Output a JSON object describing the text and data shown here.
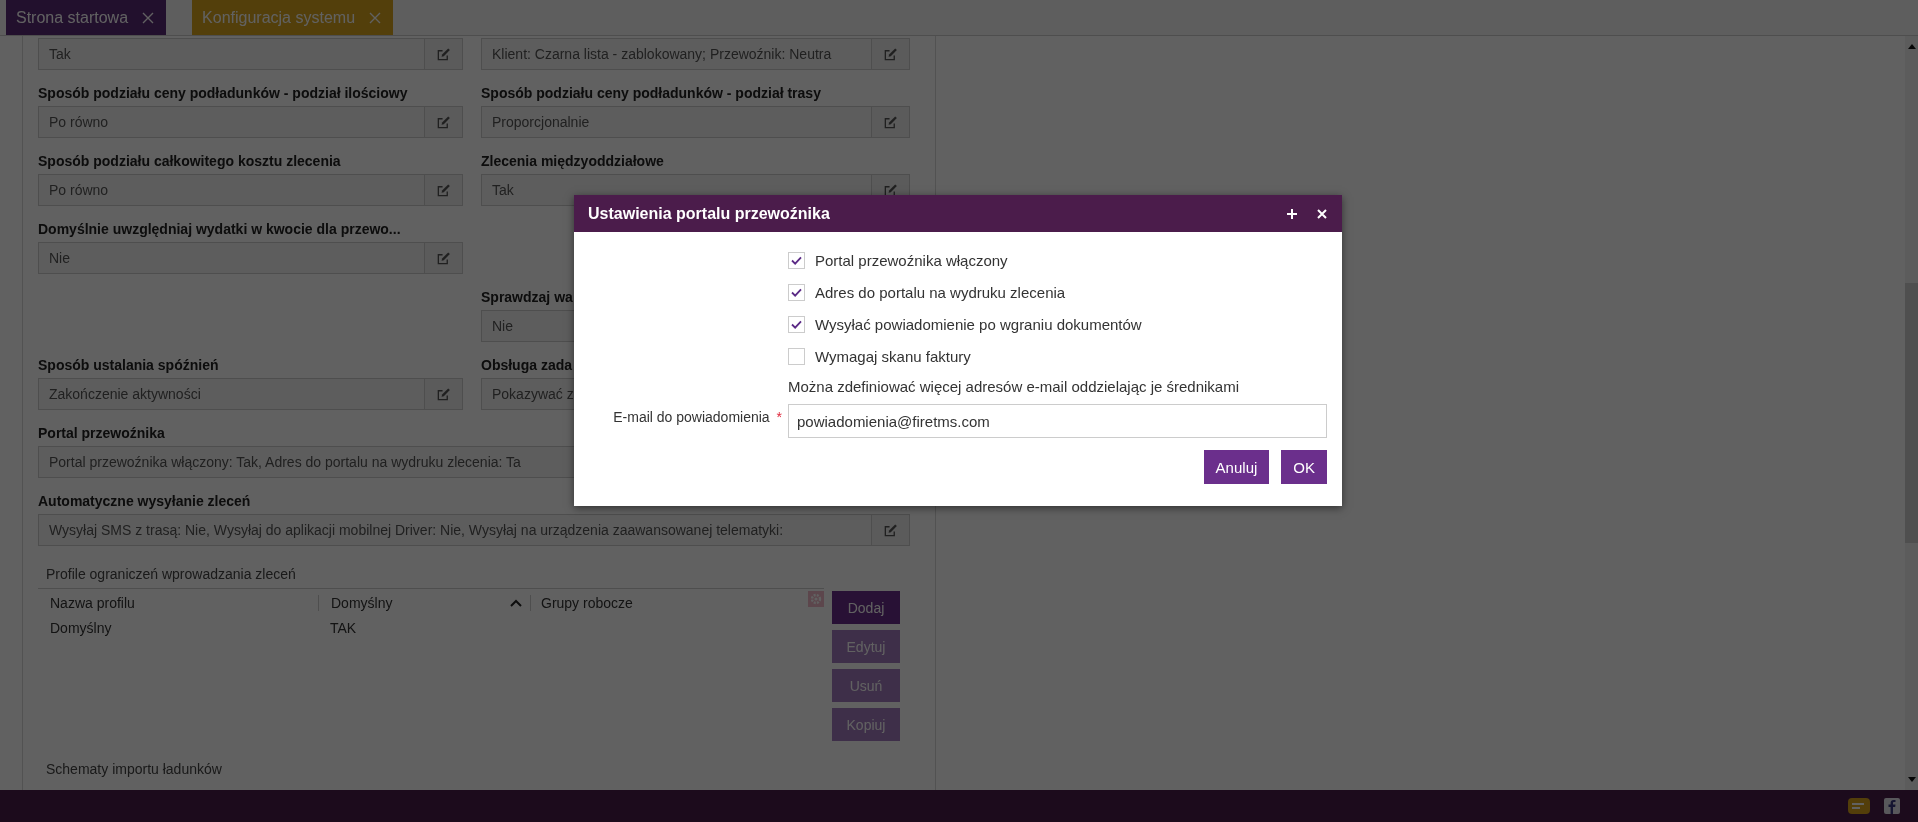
{
  "tabs": [
    {
      "label": "Strona startowa",
      "selected": false
    },
    {
      "label": "Konfiguracja systemu",
      "selected": true
    }
  ],
  "form": {
    "rows": [
      {
        "kind": "pair",
        "cells": [
          {
            "kind": "field",
            "value": "Tak",
            "editable": true
          },
          {
            "kind": "field",
            "value": "Klient: Czarna lista - zablokowany; Przewoźnik: Neutra",
            "editable": true
          }
        ]
      },
      {
        "kind": "pair",
        "cells": [
          {
            "kind": "field",
            "label": "Sposób podziału ceny podładunków - podział ilościowy",
            "value": "Po równo",
            "editable": true
          },
          {
            "kind": "field",
            "label": "Sposób podziału ceny podładunków - podział trasy",
            "value": "Proporcjonalnie",
            "editable": true
          }
        ]
      },
      {
        "kind": "pair",
        "cells": [
          {
            "kind": "field",
            "label": "Sposób podziału całkowitego kosztu zlecenia",
            "value": "Po równo",
            "editable": true
          },
          {
            "kind": "field",
            "label": "Zlecenia międzyoddziałowe",
            "value": "Tak",
            "editable": true
          }
        ]
      },
      {
        "kind": "pair",
        "cells": [
          {
            "kind": "field",
            "label": "Domyślnie uwzględniaj wydatki w kwocie dla przewo...",
            "value": "Nie",
            "editable": true
          },
          {
            "kind": "blank"
          }
        ]
      },
      {
        "kind": "pair",
        "cells": [
          {
            "kind": "blank"
          },
          {
            "kind": "field",
            "label": "Sprawdzaj wa",
            "value": "Nie",
            "editable": false
          }
        ]
      },
      {
        "kind": "pair",
        "cells": [
          {
            "kind": "field",
            "label": "Sposób ustalania spóźnień",
            "value": "Zakończenie aktywności",
            "editable": true
          },
          {
            "kind": "field",
            "label": "Obsługa zada",
            "value": "Pokazywać z",
            "editable": false
          }
        ]
      },
      {
        "kind": "wide",
        "cells": [
          {
            "kind": "field",
            "label": "Portal przewoźnika",
            "value": "Portal przewoźnika włączony: Tak, Adres do portalu na wydruku zlecenia: Ta",
            "editable": false
          }
        ]
      },
      {
        "kind": "wide",
        "cells": [
          {
            "kind": "field",
            "label": "Automatyczne wysyłanie zleceń",
            "value": "Wysyłaj SMS z trasą: Nie, Wysyłaj do aplikacji mobilnej Driver: Nie, Wysyłaj na urządzenia zaawansowanej telematyki:",
            "editable": true
          }
        ]
      }
    ]
  },
  "profiles": {
    "title": "Profile ograniczeń wprowadzania zleceń",
    "columns": [
      {
        "label": "Nazwa profilu",
        "sorted": false
      },
      {
        "label": "Domyślny",
        "sorted": true
      },
      {
        "label": "Grupy robocze",
        "sorted": false
      }
    ],
    "rows": [
      [
        "Domyślny",
        "TAK",
        ""
      ]
    ],
    "buttons": [
      {
        "label": "Dodaj",
        "disabled": false
      },
      {
        "label": "Edytuj",
        "disabled": true
      },
      {
        "label": "Usuń",
        "disabled": true
      },
      {
        "label": "Kopiuj",
        "disabled": true
      }
    ]
  },
  "next_section": {
    "title": "Schematy importu ładunków"
  },
  "modal": {
    "title": "Ustawienia portalu przewoźnika",
    "checkboxes": [
      {
        "label": "Portal przewoźnika włączony",
        "checked": true
      },
      {
        "label": "Adres do portalu na wydruku zlecenia",
        "checked": true
      },
      {
        "label": "Wysyłać powiadomienie po wgraniu dokumentów",
        "checked": true
      },
      {
        "label": "Wymagaj skanu faktury",
        "checked": false
      }
    ],
    "hint": "Można zdefiniować więcej adresów e-mail oddzielając je średnikami",
    "email": {
      "label": "E-mail do powiadomienia",
      "required": true,
      "required_mark": "*",
      "value": "powiadomienia@firetms.com"
    },
    "buttons": [
      {
        "label": "Anuluj"
      },
      {
        "label": "OK"
      }
    ]
  }
}
